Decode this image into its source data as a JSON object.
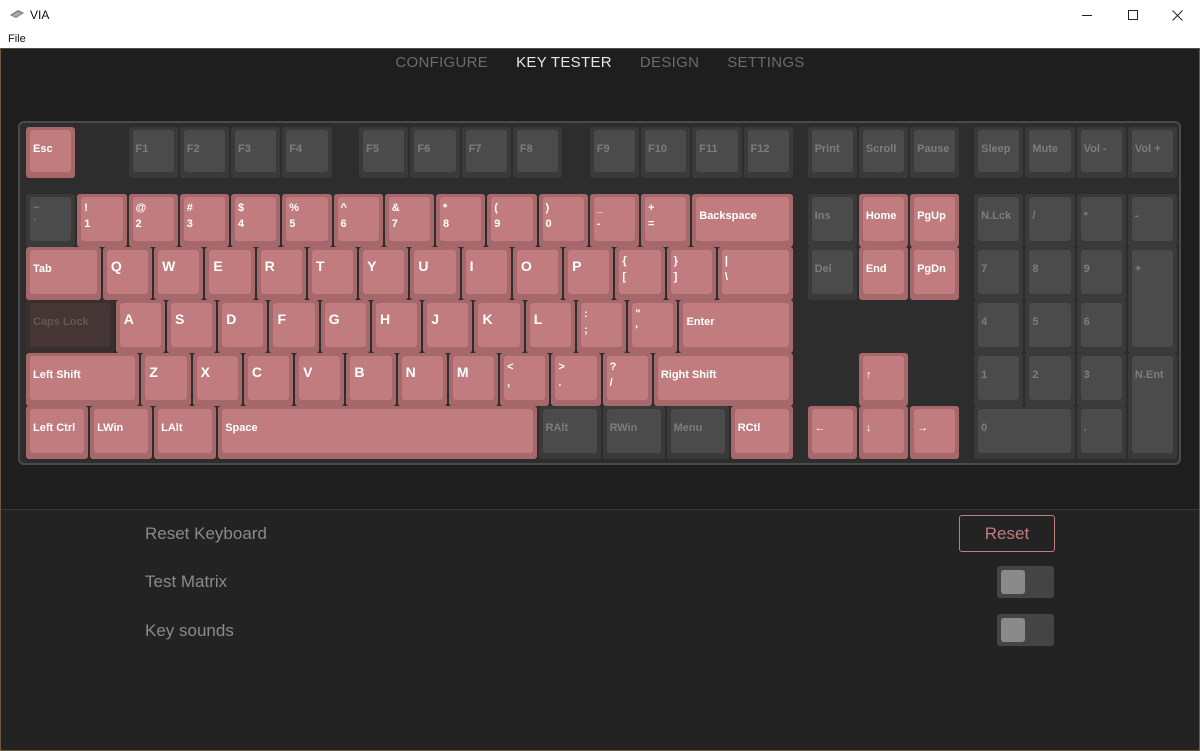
{
  "window": {
    "title": "VIA",
    "menu_file": "File",
    "controls": [
      "minimize-icon",
      "maximize-icon",
      "close-icon"
    ]
  },
  "tabs": [
    {
      "label": "CONFIGURE",
      "active": false
    },
    {
      "label": "KEY TESTER",
      "active": true
    },
    {
      "label": "DESIGN",
      "active": false
    },
    {
      "label": "SETTINGS",
      "active": false
    }
  ],
  "colors": {
    "accent": "#c07c7e",
    "key_pressed": "#c07c7e",
    "key_idle": "#4b4b4b",
    "background": "#1e1e1e"
  },
  "keyboard": {
    "keys": [
      {
        "id": "esc",
        "top": "Esc",
        "state": "pink"
      },
      {
        "id": "f1",
        "top": "F1",
        "state": "dark"
      },
      {
        "id": "f2",
        "top": "F2",
        "state": "dark"
      },
      {
        "id": "f3",
        "top": "F3",
        "state": "dark"
      },
      {
        "id": "f4",
        "top": "F4",
        "state": "dark"
      },
      {
        "id": "f5",
        "top": "F5",
        "state": "dark"
      },
      {
        "id": "f6",
        "top": "F6",
        "state": "dark"
      },
      {
        "id": "f7",
        "top": "F7",
        "state": "dark"
      },
      {
        "id": "f8",
        "top": "F8",
        "state": "dark"
      },
      {
        "id": "f9",
        "top": "F9",
        "state": "dark"
      },
      {
        "id": "f10",
        "top": "F10",
        "state": "dark"
      },
      {
        "id": "f11",
        "top": "F11",
        "state": "dark"
      },
      {
        "id": "f12",
        "top": "F12",
        "state": "dark"
      },
      {
        "id": "print",
        "top": "Print",
        "state": "dark"
      },
      {
        "id": "scroll",
        "top": "Scroll",
        "state": "dark"
      },
      {
        "id": "pause",
        "top": "Pause",
        "state": "dark"
      },
      {
        "id": "sleep",
        "top": "Sleep",
        "state": "dark"
      },
      {
        "id": "mute",
        "top": "Mute",
        "state": "dark"
      },
      {
        "id": "vol-down",
        "top": "Vol -",
        "state": "dark"
      },
      {
        "id": "vol-up",
        "top": "Vol +",
        "state": "dark"
      },
      {
        "id": "grave",
        "top": "~",
        "bot": "`",
        "state": "dark"
      },
      {
        "id": "1",
        "top": "!",
        "bot": "1",
        "state": "pink"
      },
      {
        "id": "2",
        "top": "@",
        "bot": "2",
        "state": "pink"
      },
      {
        "id": "3",
        "top": "#",
        "bot": "3",
        "state": "pink"
      },
      {
        "id": "4",
        "top": "$",
        "bot": "4",
        "state": "pink"
      },
      {
        "id": "5",
        "top": "%",
        "bot": "5",
        "state": "pink"
      },
      {
        "id": "6",
        "top": "^",
        "bot": "6",
        "state": "pink"
      },
      {
        "id": "7",
        "top": "&",
        "bot": "7",
        "state": "pink"
      },
      {
        "id": "8",
        "top": "*",
        "bot": "8",
        "state": "pink"
      },
      {
        "id": "9",
        "top": "(",
        "bot": "9",
        "state": "pink"
      },
      {
        "id": "0",
        "top": ")",
        "bot": "0",
        "state": "pink"
      },
      {
        "id": "minus",
        "top": "_",
        "bot": "-",
        "state": "pink"
      },
      {
        "id": "equal",
        "top": "+",
        "bot": "=",
        "state": "pink"
      },
      {
        "id": "backspace",
        "top": "Backspace",
        "state": "pink"
      },
      {
        "id": "ins",
        "top": "Ins",
        "state": "dark"
      },
      {
        "id": "home",
        "top": "Home",
        "state": "pink"
      },
      {
        "id": "pgup",
        "top": "PgUp",
        "state": "pink"
      },
      {
        "id": "nlck",
        "top": "N.Lck",
        "state": "dark"
      },
      {
        "id": "kp-slash",
        "top": "/",
        "state": "dark"
      },
      {
        "id": "kp-star",
        "top": "*",
        "state": "dark"
      },
      {
        "id": "kp-minus",
        "top": "-",
        "state": "dark"
      },
      {
        "id": "tab",
        "top": "Tab",
        "state": "pink"
      },
      {
        "id": "q",
        "top": "Q",
        "state": "pink"
      },
      {
        "id": "w",
        "top": "W",
        "state": "pink"
      },
      {
        "id": "e",
        "top": "E",
        "state": "pink"
      },
      {
        "id": "r",
        "top": "R",
        "state": "pink"
      },
      {
        "id": "t",
        "top": "T",
        "state": "pink"
      },
      {
        "id": "y",
        "top": "Y",
        "state": "pink"
      },
      {
        "id": "u",
        "top": "U",
        "state": "pink"
      },
      {
        "id": "i",
        "top": "I",
        "state": "pink"
      },
      {
        "id": "o",
        "top": "O",
        "state": "pink"
      },
      {
        "id": "p",
        "top": "P",
        "state": "pink"
      },
      {
        "id": "lbracket",
        "top": "{",
        "bot": "[",
        "state": "pink"
      },
      {
        "id": "rbracket",
        "top": "}",
        "bot": "]",
        "state": "pink"
      },
      {
        "id": "backslash",
        "top": "|",
        "bot": "\\",
        "state": "pink"
      },
      {
        "id": "del",
        "top": "Del",
        "state": "dark"
      },
      {
        "id": "end",
        "top": "End",
        "state": "pink"
      },
      {
        "id": "pgdn",
        "top": "PgDn",
        "state": "pink"
      },
      {
        "id": "kp7",
        "top": "7",
        "state": "dark"
      },
      {
        "id": "kp8",
        "top": "8",
        "state": "dark"
      },
      {
        "id": "kp9",
        "top": "9",
        "state": "dark"
      },
      {
        "id": "kp-plus",
        "top": "+",
        "state": "dark"
      },
      {
        "id": "capslock",
        "top": "Caps Lock",
        "state": "dim"
      },
      {
        "id": "a",
        "top": "A",
        "state": "pink"
      },
      {
        "id": "s",
        "top": "S",
        "state": "pink"
      },
      {
        "id": "d",
        "top": "D",
        "state": "pink"
      },
      {
        "id": "f",
        "top": "F",
        "state": "pink"
      },
      {
        "id": "g",
        "top": "G",
        "state": "pink"
      },
      {
        "id": "h",
        "top": "H",
        "state": "pink"
      },
      {
        "id": "j",
        "top": "J",
        "state": "pink"
      },
      {
        "id": "k",
        "top": "K",
        "state": "pink"
      },
      {
        "id": "l",
        "top": "L",
        "state": "pink"
      },
      {
        "id": "semicolon",
        "top": ":",
        "bot": ";",
        "state": "pink"
      },
      {
        "id": "quote",
        "top": "\"",
        "bot": "'",
        "state": "pink"
      },
      {
        "id": "enter",
        "top": "Enter",
        "state": "pink"
      },
      {
        "id": "kp4",
        "top": "4",
        "state": "dark"
      },
      {
        "id": "kp5",
        "top": "5",
        "state": "dark"
      },
      {
        "id": "kp6",
        "top": "6",
        "state": "dark"
      },
      {
        "id": "lshift",
        "top": "Left Shift",
        "state": "pink"
      },
      {
        "id": "z",
        "top": "Z",
        "state": "pink"
      },
      {
        "id": "x",
        "top": "X",
        "state": "pink"
      },
      {
        "id": "c",
        "top": "C",
        "state": "pink"
      },
      {
        "id": "v",
        "top": "V",
        "state": "pink"
      },
      {
        "id": "b",
        "top": "B",
        "state": "pink"
      },
      {
        "id": "n",
        "top": "N",
        "state": "pink"
      },
      {
        "id": "m",
        "top": "M",
        "state": "pink"
      },
      {
        "id": "comma",
        "top": "<",
        "bot": ",",
        "state": "pink"
      },
      {
        "id": "period",
        "top": ">",
        "bot": ".",
        "state": "pink"
      },
      {
        "id": "slash",
        "top": "?",
        "bot": "/",
        "state": "pink"
      },
      {
        "id": "rshift",
        "top": "Right Shift",
        "state": "pink"
      },
      {
        "id": "up",
        "top": "↑",
        "state": "pink"
      },
      {
        "id": "kp1",
        "top": "1",
        "state": "dark"
      },
      {
        "id": "kp2",
        "top": "2",
        "state": "dark"
      },
      {
        "id": "kp3",
        "top": "3",
        "state": "dark"
      },
      {
        "id": "kp-enter",
        "top": "N.Ent",
        "state": "dark"
      },
      {
        "id": "lctrl",
        "top": "Left Ctrl",
        "state": "pink"
      },
      {
        "id": "lwin",
        "top": "LWin",
        "state": "pink"
      },
      {
        "id": "lalt",
        "top": "LAlt",
        "state": "pink"
      },
      {
        "id": "space",
        "top": "Space",
        "state": "pink"
      },
      {
        "id": "ralt",
        "top": "RAlt",
        "state": "dark"
      },
      {
        "id": "rwin",
        "top": "RWin",
        "state": "dark"
      },
      {
        "id": "menu",
        "top": "Menu",
        "state": "dark"
      },
      {
        "id": "rctrl",
        "top": "RCtl",
        "state": "pink"
      },
      {
        "id": "left",
        "top": "←",
        "state": "pink"
      },
      {
        "id": "down",
        "top": "↓",
        "state": "pink"
      },
      {
        "id": "right",
        "top": "→",
        "state": "pink"
      },
      {
        "id": "kp0",
        "top": "0",
        "state": "dark"
      },
      {
        "id": "kp-dot",
        "top": ".",
        "state": "dark"
      }
    ]
  },
  "settings": {
    "reset_keyboard_label": "Reset Keyboard",
    "reset_button": "Reset",
    "test_matrix_label": "Test Matrix",
    "test_matrix_on": false,
    "key_sounds_label": "Key sounds",
    "key_sounds_on": false
  }
}
